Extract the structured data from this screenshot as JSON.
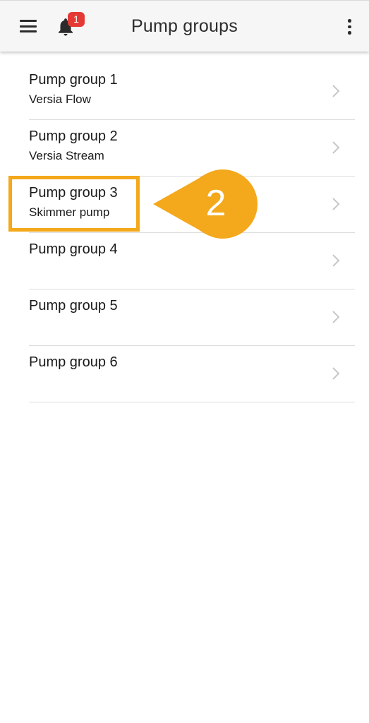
{
  "header": {
    "title": "Pump groups",
    "notification_count": "1"
  },
  "pump_groups": [
    {
      "name": "Pump group 1",
      "description": "Versia Flow"
    },
    {
      "name": "Pump group 2",
      "description": "Versia Stream"
    },
    {
      "name": "Pump group 3",
      "description": "Skimmer pump"
    },
    {
      "name": "Pump group 4",
      "description": ""
    },
    {
      "name": "Pump group 5",
      "description": ""
    },
    {
      "name": "Pump group 6",
      "description": ""
    }
  ],
  "callout": {
    "number": "2"
  },
  "colors": {
    "accent": "#f4a81c",
    "badge": "#e53935",
    "appbar": "#f6f6f6"
  }
}
